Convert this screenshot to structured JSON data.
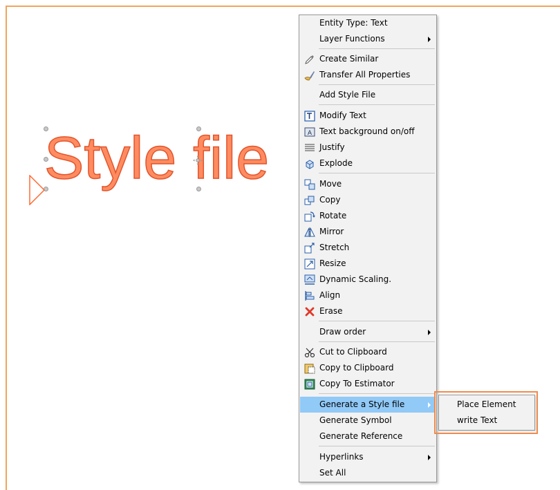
{
  "canvas": {
    "entity_text": "Style file",
    "accent_color": "#ff8c60",
    "border_color": "#f0a45a"
  },
  "context_menu": {
    "items": [
      {
        "label": "Entity Type: Text",
        "icon": "",
        "submenu": false
      },
      {
        "label": "Layer Functions",
        "icon": "",
        "submenu": true
      },
      {
        "label": "Create Similar",
        "icon": "dropper-icon",
        "submenu": false
      },
      {
        "label": "Transfer All Properties",
        "icon": "brush-icon",
        "submenu": false
      },
      {
        "label": "Add Style File",
        "icon": "",
        "submenu": false
      },
      {
        "label": "Modify Text",
        "icon": "modify-text-icon",
        "submenu": false
      },
      {
        "label": "Text background on/off",
        "icon": "text-background-icon",
        "submenu": false
      },
      {
        "label": "Justify",
        "icon": "justify-icon",
        "submenu": false
      },
      {
        "label": "Explode",
        "icon": "explode-icon",
        "submenu": false
      },
      {
        "label": "Move",
        "icon": "move-icon",
        "submenu": false
      },
      {
        "label": "Copy",
        "icon": "copy-icon",
        "submenu": false
      },
      {
        "label": "Rotate",
        "icon": "rotate-icon",
        "submenu": false
      },
      {
        "label": "Mirror",
        "icon": "mirror-icon",
        "submenu": false
      },
      {
        "label": "Stretch",
        "icon": "stretch-icon",
        "submenu": false
      },
      {
        "label": "Resize",
        "icon": "resize-icon",
        "submenu": false
      },
      {
        "label": "Dynamic Scaling.",
        "icon": "dynamic-scaling-icon",
        "submenu": false
      },
      {
        "label": "Align",
        "icon": "align-icon",
        "submenu": false
      },
      {
        "label": "Erase",
        "icon": "erase-icon",
        "submenu": false
      },
      {
        "label": "Draw order",
        "icon": "",
        "submenu": true
      },
      {
        "label": "Cut to Clipboard",
        "icon": "scissors-icon",
        "submenu": false
      },
      {
        "label": "Copy to Clipboard",
        "icon": "clipboard-icon",
        "submenu": false
      },
      {
        "label": "Copy To Estimator",
        "icon": "estimator-icon",
        "submenu": false
      },
      {
        "label": "Generate a Style file",
        "icon": "",
        "submenu": true,
        "highlighted": true
      },
      {
        "label": "Generate Symbol",
        "icon": "",
        "submenu": false
      },
      {
        "label": "Generate Reference",
        "icon": "",
        "submenu": false
      },
      {
        "label": "Hyperlinks",
        "icon": "",
        "submenu": true
      },
      {
        "label": "Set All",
        "icon": "",
        "submenu": false
      }
    ],
    "highlight_color": "#91c9f7"
  },
  "submenu": {
    "items": [
      {
        "label": "Place Element"
      },
      {
        "label": "write Text"
      }
    ],
    "outline_color": "#f08a4c"
  }
}
